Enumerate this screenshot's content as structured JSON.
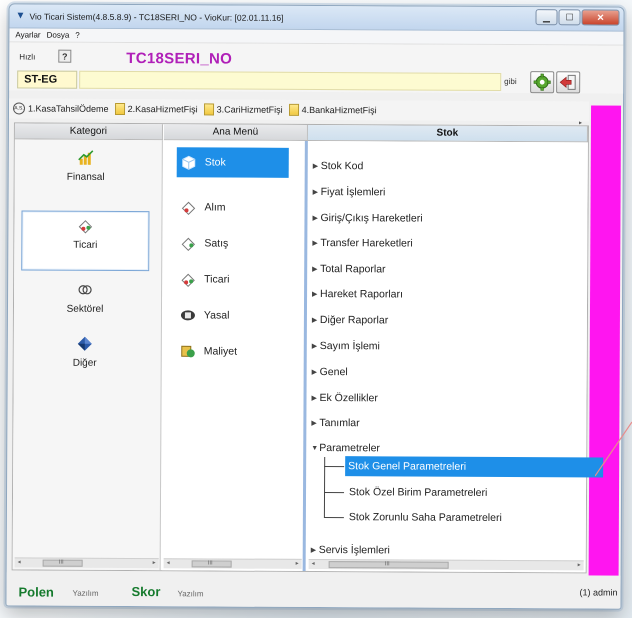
{
  "window": {
    "title": "Vio Ticari Sistem(4.8.5.8.9)  - TC18SERI_NO - VioKur: [02.01.11.16]",
    "buttons": {
      "minimize": "▁",
      "maximize": "☐",
      "close": "✕"
    }
  },
  "menu": [
    "Ayarlar",
    "Dosya",
    "?"
  ],
  "quickbar": {
    "hizli_label": "Hızlı",
    "help_label": "?",
    "serial_title": "TC18SERI_NO",
    "steg_value": "ST-EG",
    "gibi_label": "gibi"
  },
  "tabs": [
    {
      "label": "1.KasaTahsilÖdeme",
      "badge": "A.S."
    },
    {
      "label": "2.KasaHizmetFişi"
    },
    {
      "label": "3.CariHizmetFişi"
    },
    {
      "label": "4.BankaHizmetFişi"
    }
  ],
  "panels": {
    "kategori_header": "Kategori",
    "anamenu_header": "Ana Menü",
    "stok_header": "Stok"
  },
  "kategori": [
    {
      "label": "Finansal"
    },
    {
      "label": "Ticari",
      "selected": true
    },
    {
      "label": "Sektörel"
    },
    {
      "label": "Diğer"
    }
  ],
  "anamenu": [
    {
      "label": "Stok",
      "selected": true
    },
    {
      "label": "Alım"
    },
    {
      "label": "Satış"
    },
    {
      "label": "Ticari"
    },
    {
      "label": "Yasal"
    },
    {
      "label": "Maliyet"
    }
  ],
  "stok_tree": [
    "Stok Kod",
    "Fiyat İşlemleri",
    "Giriş/Çıkış Hareketleri",
    "Transfer Hareketleri",
    "Total Raporlar",
    "Hareket Raporları",
    "Diğer Raporlar",
    "Sayım İşlemi",
    "Genel",
    "Ek Özellikler",
    "Tanımlar",
    "Parametreler",
    "Servis İşlemleri"
  ],
  "parametreler_children": [
    {
      "label": "Stok Genel Parametreleri",
      "selected": true
    },
    {
      "label": "Stok Özel Birim Parametreleri"
    },
    {
      "label": "Stok Zorunlu Saha Parametreleri"
    }
  ],
  "scroll": {
    "left_arrow": "◂",
    "right_arrow": "▸",
    "thumb_grip": "III"
  },
  "footer": {
    "polen": "Polen",
    "polen_sub": "Yazılım",
    "skor": "Skor",
    "skor_sub": "Yazılım",
    "user": "(1) admin"
  },
  "colors": {
    "accent_blue": "#1e8fe8",
    "magenta": "#ff15f0",
    "serial_purple": "#b020b8",
    "brand_green": "#157a2d"
  }
}
